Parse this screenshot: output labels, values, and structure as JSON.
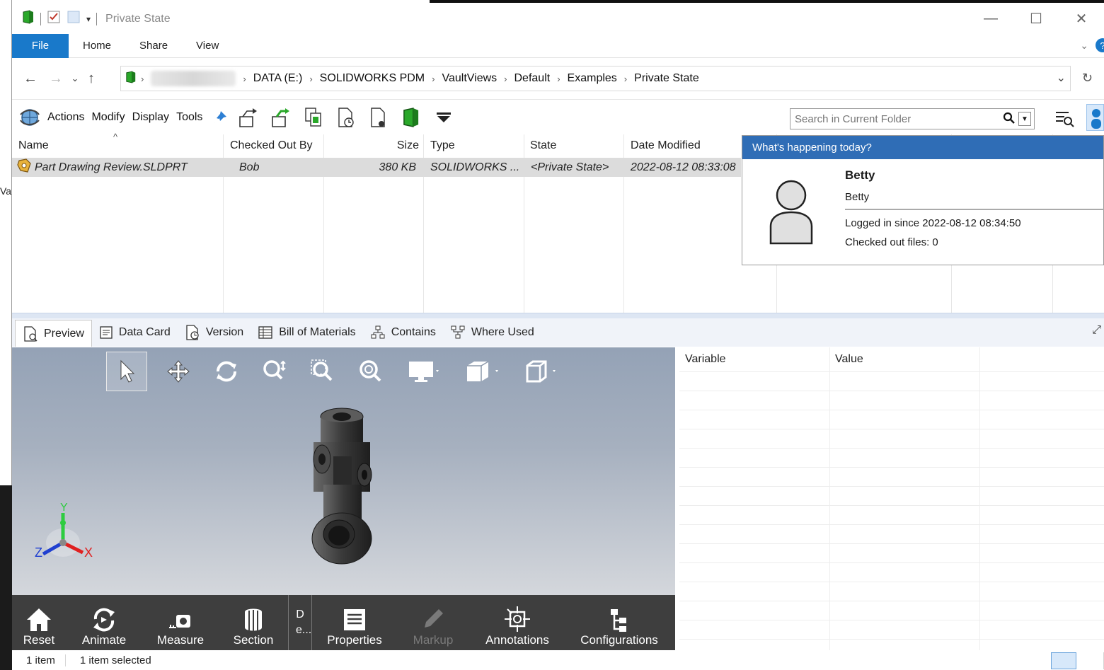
{
  "window": {
    "title": "Private State",
    "controls": [
      "minimize",
      "maximize",
      "close"
    ]
  },
  "ribbon": {
    "tabs": [
      "File",
      "Home",
      "Share",
      "View"
    ]
  },
  "navigation": {
    "breadcrumbs": [
      "DATA (E:)",
      "SOLIDWORKS PDM",
      "VaultViews",
      "Default",
      "Examples",
      "Private State"
    ]
  },
  "pdm_toolbar": {
    "menus": [
      "Actions",
      "Modify",
      "Display",
      "Tools"
    ],
    "search_placeholder": "Search in Current Folder"
  },
  "file_list": {
    "columns": [
      "Name",
      "Checked Out By",
      "Size",
      "Type",
      "State",
      "Date Modified"
    ],
    "rows": [
      {
        "name": "Part Drawing Review.SLDPRT",
        "checked_out_by": "Bob",
        "size": "380 KB",
        "type": "SOLIDWORKS ...",
        "state": "<Private State>",
        "date_modified": "2022-08-12 08:33:08"
      }
    ]
  },
  "popup": {
    "header": "What's happening today?",
    "name": "Betty",
    "username": "Betty",
    "logged_in": "Logged in since 2022-08-12 08:34:50",
    "checked_out": "Checked out files: 0"
  },
  "preview_tabs": [
    "Preview",
    "Data Card",
    "Version",
    "Bill of Materials",
    "Contains",
    "Where Used"
  ],
  "viewer": {
    "axes": {
      "x": "X",
      "y": "Y",
      "z": "Z"
    },
    "bottom_buttons": [
      {
        "label": "Reset",
        "enabled": true
      },
      {
        "label": "Animate",
        "enabled": true
      },
      {
        "label": "Measure",
        "enabled": true
      },
      {
        "label": "Section",
        "enabled": true
      },
      {
        "label": "De...",
        "enabled": true
      },
      {
        "label": "Properties",
        "enabled": true
      },
      {
        "label": "Markup",
        "enabled": false
      },
      {
        "label": "Annotations",
        "enabled": true
      },
      {
        "label": "Configurations",
        "enabled": true
      }
    ]
  },
  "variables_grid": {
    "columns": [
      "Variable",
      "Value"
    ]
  },
  "status_bar": {
    "item_count": "1 item",
    "selected": "1 item selected"
  },
  "colors": {
    "accent": "#1979ca",
    "popup_header": "#2f6db6",
    "vault_green": "#2aa82a"
  }
}
